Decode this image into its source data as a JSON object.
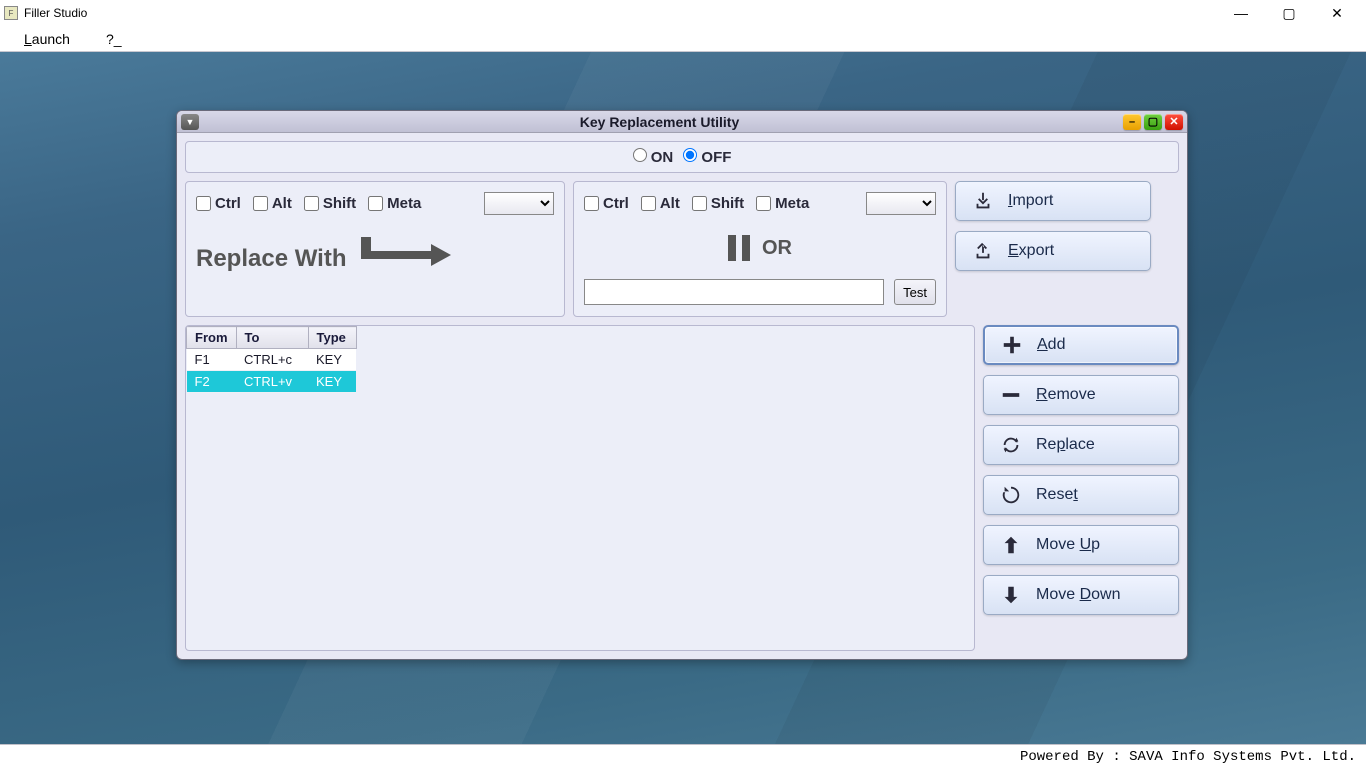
{
  "window": {
    "title": "Filler Studio"
  },
  "menubar": {
    "launch": "Launch",
    "help": "?_"
  },
  "dialog": {
    "title": "Key Replacement Utility",
    "onoff": {
      "on_label": "ON",
      "off_label": "OFF",
      "state": "off"
    },
    "modifiers": {
      "ctrl": "Ctrl",
      "alt": "Alt",
      "shift": "Shift",
      "meta": "Meta"
    },
    "replace_with_label": "Replace With",
    "or_label": "OR",
    "test_label": "Test",
    "buttons": {
      "import": "Import",
      "export": "Export",
      "add": "Add",
      "remove": "Remove",
      "replace": "Replace",
      "reset": "Reset",
      "moveup": "Move Up",
      "movedown": "Move Down"
    },
    "table": {
      "headers": {
        "from": "From",
        "to": "To",
        "type": "Type"
      },
      "rows": [
        {
          "from": "F1",
          "to": "CTRL+c",
          "type": "KEY",
          "selected": false
        },
        {
          "from": "F2",
          "to": "CTRL+v",
          "type": "KEY",
          "selected": true
        }
      ]
    }
  },
  "statusbar": {
    "text": "Powered By : SAVA Info Systems Pvt. Ltd."
  }
}
